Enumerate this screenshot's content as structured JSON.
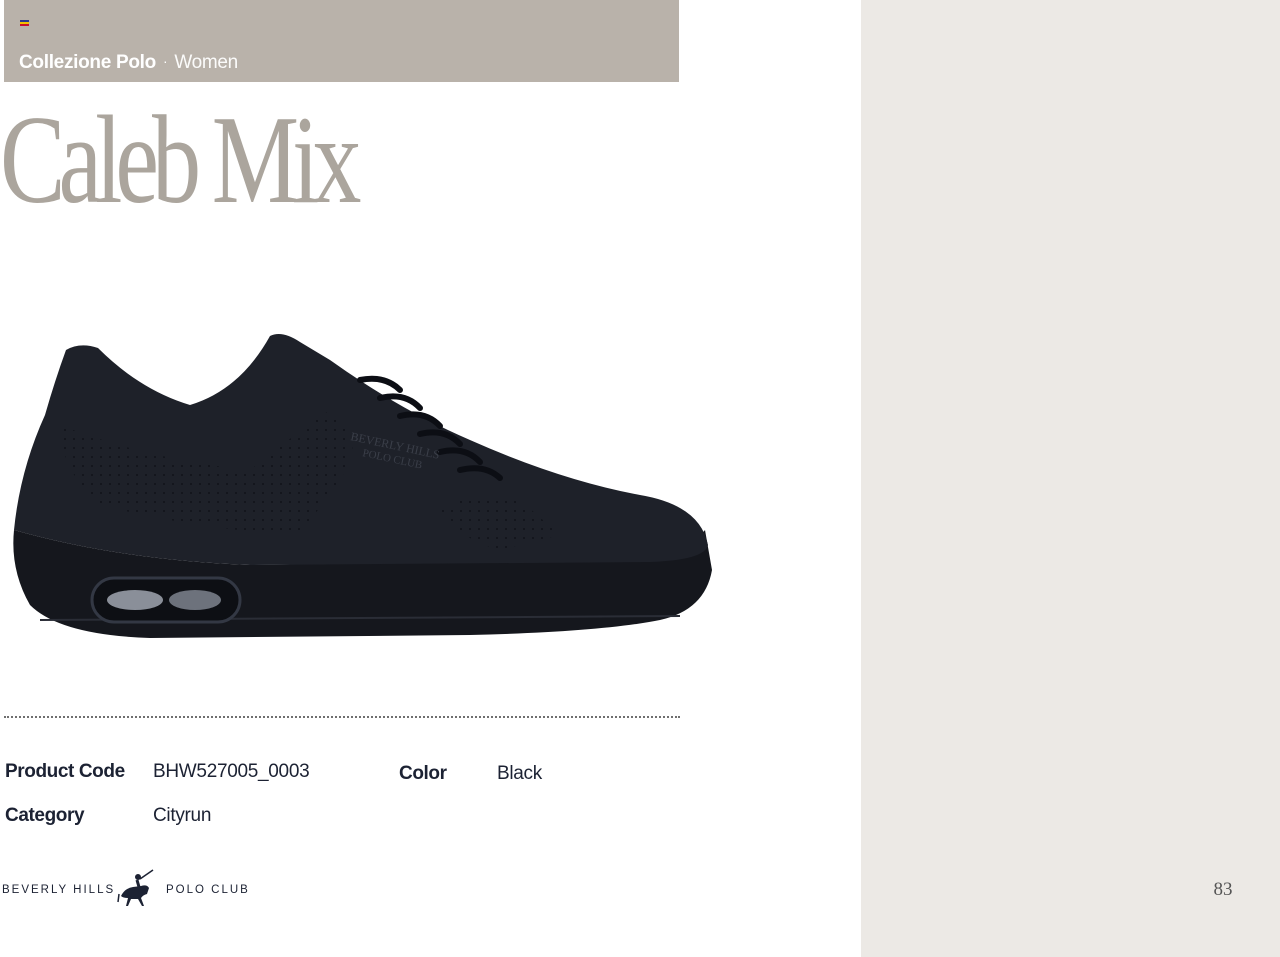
{
  "header": {
    "collection": "Collezione Polo",
    "separator": "·",
    "section": "Women"
  },
  "product": {
    "title": "Caleb Mix",
    "image": "black-sneaker-image"
  },
  "specs": {
    "product_code_label": "Product Code",
    "product_code_value": "BHW527005_0003",
    "color_label": "Color",
    "color_value": "Black",
    "category_label": "Category",
    "category_value": "Cityrun"
  },
  "footer": {
    "brand_left": "BEVERLY HILLS",
    "brand_right": "POLO CLUB",
    "logo_icon": "polo-player-icon"
  },
  "page": {
    "number": "83"
  },
  "colors": {
    "header_bar": "#b9b2aa",
    "title": "#aba59d",
    "right_panel": "#ece9e5",
    "text_dark": "#1c2233"
  }
}
